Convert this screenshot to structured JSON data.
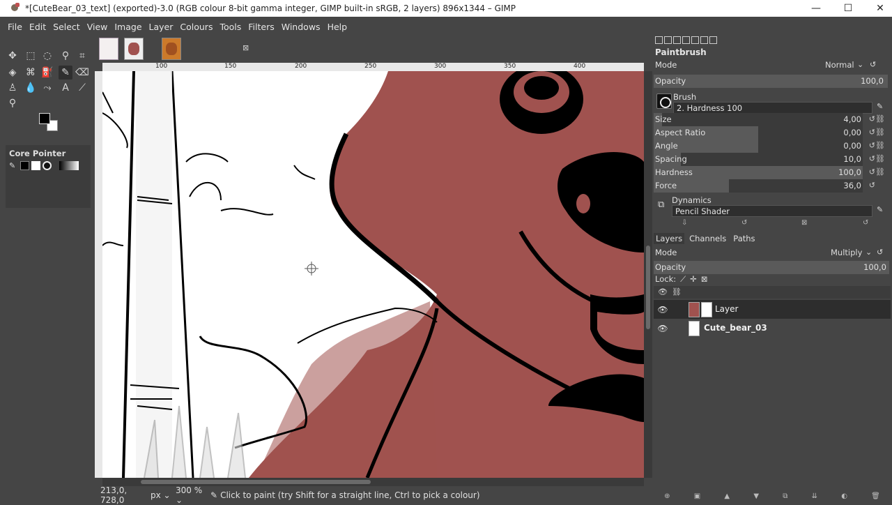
{
  "window": {
    "title": "*[CuteBear_03_text] (exported)-3.0 (RGB colour 8-bit gamma integer, GIMP built-in sRGB, 2 layers) 896x1344 – GIMP",
    "minimize": "—",
    "maximize": "☐",
    "close": "✕"
  },
  "menu": [
    "File",
    "Edit",
    "Select",
    "View",
    "Image",
    "Layer",
    "Colours",
    "Tools",
    "Filters",
    "Windows",
    "Help"
  ],
  "toolbox": {
    "tool_options_title": "Core Pointer"
  },
  "rulers": {
    "top": [
      "100",
      "150",
      "200",
      "250",
      "300",
      "350",
      "400"
    ]
  },
  "statusbar": {
    "coords": "213,0, 728,0",
    "unit": "px ⌄",
    "zoom": "300 % ⌄",
    "message": "Click to paint (try Shift for a straight line, Ctrl to pick a colour)"
  },
  "tool_options": {
    "title": "Paintbrush",
    "mode_label": "Mode",
    "mode_value": "Normal",
    "opacity_label": "Opacity",
    "opacity_value": "100,0",
    "brush_label": "Brush",
    "brush_value": "2. Hardness 100",
    "size_label": "Size",
    "size_value": "4,00",
    "size_fraction": 0.04,
    "aspect_label": "Aspect Ratio",
    "aspect_value": "0,00",
    "aspect_fraction": 0.5,
    "angle_label": "Angle",
    "angle_value": "0,00",
    "angle_fraction": 0.5,
    "spacing_label": "Spacing",
    "spacing_value": "10,0",
    "spacing_fraction": 0.13,
    "hardness_label": "Hardness",
    "hardness_value": "100,0",
    "hardness_fraction": 1.0,
    "force_label": "Force",
    "force_value": "36,0",
    "force_fraction": 0.36,
    "dynamics_label": "Dynamics",
    "dynamics_value": "Pencil Shader"
  },
  "layers_panel": {
    "tabs": [
      "Layers",
      "Channels",
      "Paths"
    ],
    "mode_label": "Mode",
    "mode_value": "Multiply",
    "opacity_label": "Opacity",
    "opacity_value": "100,0",
    "lock_label": "Lock:",
    "layers": [
      {
        "name": "Layer",
        "selected": true
      },
      {
        "name": "Cute_bear_03",
        "selected": false
      }
    ]
  },
  "colors": {
    "bear": "#a0524f",
    "ui_dark": "#454545",
    "fg": "#000000",
    "bg": "#ffffff"
  }
}
